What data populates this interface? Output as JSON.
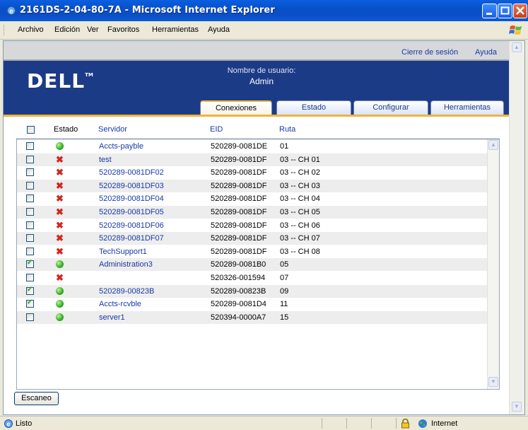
{
  "window": {
    "title": "2161DS-2-04-80-7A - Microsoft Internet Explorer"
  },
  "menu": [
    "Archivo",
    "Edición",
    "Ver",
    "Favoritos",
    "Herramientas",
    "Ayuda"
  ],
  "toplinks": {
    "logout": "Cierre de sesión",
    "help": "Ayuda"
  },
  "banner": {
    "logo": "DELL",
    "logo_tm": "TM",
    "user_label": "Nombre de usuario:",
    "user_name": "Admin"
  },
  "tabs": [
    "Conexiones",
    "Estado",
    "Configurar",
    "Herramientas"
  ],
  "active_tab": "Conexiones",
  "table": {
    "headers": {
      "status": "Estado",
      "server": "Servidor",
      "eid": "EID",
      "route": "Ruta"
    },
    "rows": [
      {
        "checked": false,
        "status": "online",
        "server": "Accts-payble",
        "eid": "520289-0081DE",
        "route": "01"
      },
      {
        "checked": false,
        "status": "offline",
        "server": "test",
        "eid": "520289-0081DF",
        "route": "03 -- CH 01"
      },
      {
        "checked": false,
        "status": "offline",
        "server": "520289-0081DF02",
        "eid": "520289-0081DF",
        "route": "03 -- CH 02"
      },
      {
        "checked": false,
        "status": "offline",
        "server": "520289-0081DF03",
        "eid": "520289-0081DF",
        "route": "03 -- CH 03"
      },
      {
        "checked": false,
        "status": "offline",
        "server": "520289-0081DF04",
        "eid": "520289-0081DF",
        "route": "03 -- CH 04"
      },
      {
        "checked": false,
        "status": "offline",
        "server": "520289-0081DF05",
        "eid": "520289-0081DF",
        "route": "03 -- CH 05"
      },
      {
        "checked": false,
        "status": "offline",
        "server": "520289-0081DF06",
        "eid": "520289-0081DF",
        "route": "03 -- CH 06"
      },
      {
        "checked": false,
        "status": "offline",
        "server": "520289-0081DF07",
        "eid": "520289-0081DF",
        "route": "03 -- CH 07"
      },
      {
        "checked": false,
        "status": "offline",
        "server": "TechSupport1",
        "eid": "520289-0081DF",
        "route": "03 -- CH 08"
      },
      {
        "checked": true,
        "status": "online",
        "server": "Administration3",
        "eid": "520289-0081B0",
        "route": "05"
      },
      {
        "checked": false,
        "status": "offline",
        "server": "",
        "eid": "520326-001594",
        "route": "07"
      },
      {
        "checked": true,
        "status": "online",
        "server": "520289-00823B",
        "eid": "520289-00823B",
        "route": "09"
      },
      {
        "checked": true,
        "status": "online",
        "server": "Accts-rcvble",
        "eid": "520289-0081D4",
        "route": "11"
      },
      {
        "checked": false,
        "status": "online",
        "server": "server1",
        "eid": "520394-0000A7",
        "route": "15"
      }
    ]
  },
  "scan_button": "Escaneo",
  "statusbar": {
    "text": "Listo",
    "zone": "Internet"
  },
  "colors": {
    "banner": "#1c3b87",
    "tab_accent": "#f0b439",
    "link": "#183aa5",
    "online": "#3db32a",
    "offline": "#d2261f"
  }
}
